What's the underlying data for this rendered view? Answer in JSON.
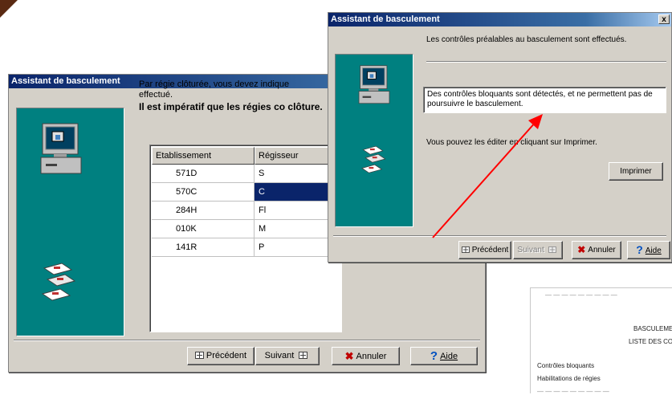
{
  "dialog_back": {
    "title": "Assistant de basculement",
    "intro_text": "Par régie clôturée, vous devez indique effectué.",
    "bold_text": "Il est impératif que les régies co clôture.",
    "table": {
      "columns": [
        "Etablissement",
        "Régisseur"
      ],
      "rows": [
        [
          "571D",
          "S"
        ],
        [
          "570C",
          "C"
        ],
        [
          "284H",
          "Fl"
        ],
        [
          "010K",
          "M"
        ],
        [
          "141R",
          "P"
        ]
      ],
      "selected_row": 1
    },
    "buttons": {
      "precedent": "Précédent",
      "suivant": "Suivant",
      "annuler": "Annuler",
      "aide": "Aide"
    }
  },
  "dialog_front": {
    "title": "Assistant de basculement",
    "close_glyph": "x",
    "header_text": "Les contrôles préalables au basculement sont effectués.",
    "message": "Des contrôles bloquants sont détectés, et ne permettent pas de poursuivre le basculement.",
    "print_text": "Vous pouvez les éditer en cliquant sur Imprimer.",
    "print_button": "Imprimer",
    "buttons": {
      "precedent": "Précédent",
      "suivant": "Suivant",
      "annuler": "Annuler",
      "aide": "Aide"
    }
  },
  "report": {
    "title": "BASCULEMEN",
    "subtitle": "LISTE DES CON",
    "line1": "Contrôles bloquants",
    "line2": "Habilitations de régies"
  },
  "colors": {
    "dialog_bg": "#d4d0c8",
    "titlebar": "#0a246a",
    "teal_panel": "#008080",
    "selection": "#0a246a",
    "arrow": "#ff0000"
  }
}
